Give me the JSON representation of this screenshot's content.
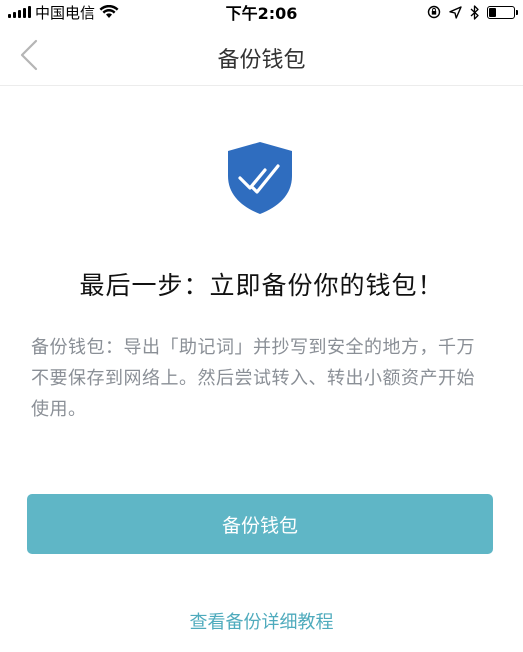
{
  "status_bar": {
    "carrier": "中国电信",
    "time": "下午2:06",
    "battery_level": 0.3,
    "icons": [
      "signal-icon",
      "wifi-icon",
      "orientation-lock-icon",
      "location-icon",
      "bluetooth-icon",
      "battery-icon"
    ]
  },
  "nav": {
    "title": "备份钱包",
    "back_icon": "chevron-left-icon"
  },
  "hero": {
    "icon": "shield-check-icon",
    "icon_color": "#2f6dbf"
  },
  "content": {
    "headline": "最后一步：立即备份你的钱包！",
    "description": "备份钱包：导出「助记词」并抄写到安全的地方，千万不要保存到网络上。然后尝试转入、转出小额资产开始使用。"
  },
  "actions": {
    "backup_button_label": "备份钱包",
    "backup_button_color": "#5fb6c6",
    "tutorial_link_label": "查看备份详细教程",
    "tutorial_link_color": "#4fabbd"
  }
}
